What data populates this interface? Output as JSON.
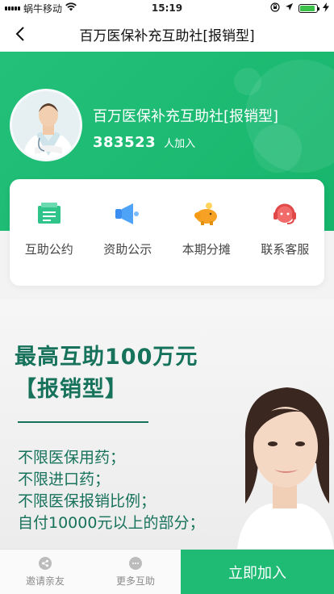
{
  "status_bar": {
    "carrier": "蜗牛移动",
    "time": "15:19",
    "battery_level": 0.9
  },
  "nav": {
    "title": "百万医保补充互助社[报销型]",
    "back_icon": "chevron-left-icon"
  },
  "header": {
    "org_name": "百万医保补充互助社[报销型]",
    "member_count": "383523",
    "member_suffix": "人加入",
    "accent": "#1fbb75"
  },
  "menu": [
    {
      "label": "互助公约",
      "icon": "document-icon"
    },
    {
      "label": "资助公示",
      "icon": "megaphone-icon"
    },
    {
      "label": "本期分摊",
      "icon": "piggy-bank-icon"
    },
    {
      "label": "联系客服",
      "icon": "headset-icon"
    }
  ],
  "banner": {
    "headline": "最高互助100万元",
    "subheadline": "【报销型】",
    "lines": [
      "不限医保用药；",
      "不限进口药；",
      "不限医保报销比例；",
      "自付10000元以上的部分；"
    ],
    "text_color": "#16725a"
  },
  "bottom_bar": {
    "invite_label": "邀请亲友",
    "more_label": "更多互助",
    "join_label": "立即加入"
  }
}
